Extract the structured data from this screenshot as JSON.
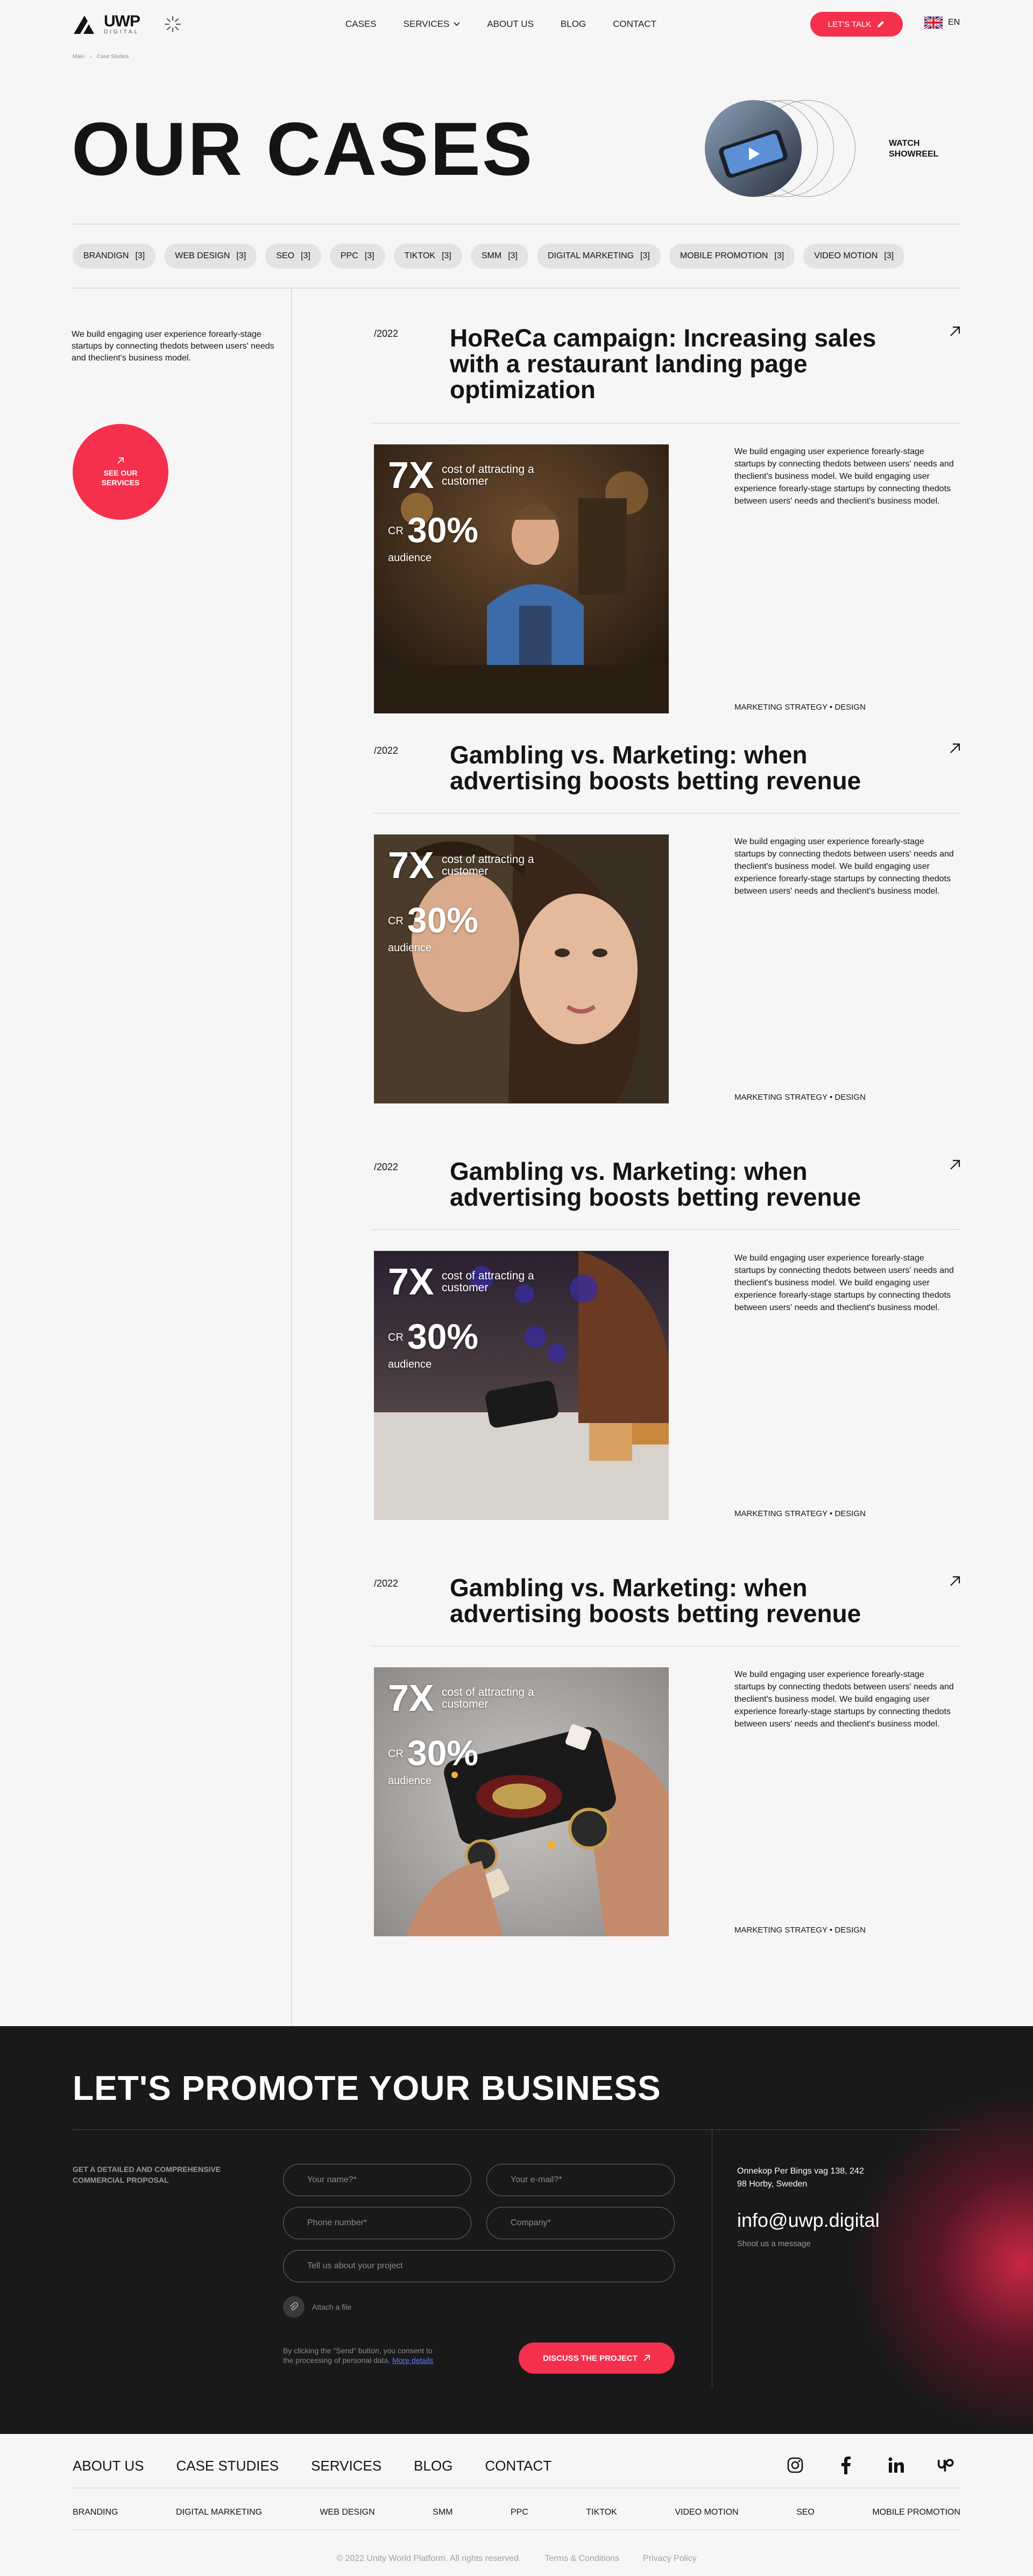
{
  "header": {
    "logo_text": "UWP",
    "logo_sub": "DIGITAL",
    "nav": [
      "CASES",
      "SERVICES",
      "ABOUT US",
      "BLOG",
      "CONTACT"
    ],
    "cta": "LET'S TALK",
    "lang": "EN"
  },
  "breadcrumb": [
    "Main",
    "Case Studies"
  ],
  "hero": {
    "title": "OUR CASES",
    "showreel_label_1": "WATCH",
    "showreel_label_2": "SHOWREEL"
  },
  "filters": [
    {
      "label": "BRANDIGN",
      "count": "[3]"
    },
    {
      "label": "WEB DESIGN",
      "count": "[3]"
    },
    {
      "label": "SEO",
      "count": "[3]"
    },
    {
      "label": "PPC",
      "count": "[3]"
    },
    {
      "label": "TIKTOK",
      "count": "[3]"
    },
    {
      "label": "SMM",
      "count": "[3]"
    },
    {
      "label": "DIGITAL MARKETING",
      "count": "[3]"
    },
    {
      "label": "MOBILE PROMOTION",
      "count": "[3]"
    },
    {
      "label": "VIDEO MOTION",
      "count": "[3]"
    }
  ],
  "sidebar": {
    "intro": "We build engaging user experience forearly-stage startups by connecting thedots between users' needs and theclient's business model.",
    "button_line1": "SEE OUR",
    "button_line2": "SERVICES"
  },
  "cases": [
    {
      "year": "/2022",
      "title": "HoReCa campaign: Increasing sales with a restaurant landing page optimization",
      "stat_big": "7X",
      "stat_big_label": "cost of attracting a customer",
      "stat_cr": "CR",
      "stat_pct": "30%",
      "stat_aud": "audience",
      "desc": "We build engaging user experience forearly-stage startups by connecting thedots between users' needs and theclient's business model. We build engaging user experience forearly-stage startups by connecting thedots between users' needs and theclient's business model.",
      "tags": "MARKETING STRATEGY • DESIGN"
    },
    {
      "year": "/2022",
      "title": "Gambling vs. Marketing: when advertising boosts betting revenue",
      "stat_big": "7X",
      "stat_big_label": "cost of attracting a customer",
      "stat_cr": "CR",
      "stat_pct": "30%",
      "stat_aud": "audience",
      "desc": "We build engaging user experience forearly-stage startups by connecting thedots between users' needs and theclient's business model. We build engaging user experience forearly-stage startups by connecting thedots between users' needs and theclient's business model.",
      "tags": "MARKETING STRATEGY • DESIGN"
    },
    {
      "year": "/2022",
      "title": "Gambling vs. Marketing: when advertising boosts betting revenue",
      "stat_big": "7X",
      "stat_big_label": "cost of attracting a customer",
      "stat_cr": "CR",
      "stat_pct": "30%",
      "stat_aud": "audience",
      "desc": "We build engaging user experience forearly-stage startups by connecting thedots between users' needs and theclient's business model. We build engaging user experience forearly-stage startups by connecting thedots between users' needs and theclient's business model.",
      "tags": "MARKETING STRATEGY • DESIGN"
    },
    {
      "year": "/2022",
      "title": "Gambling vs. Marketing: when advertising boosts betting revenue",
      "stat_big": "7X",
      "stat_big_label": "cost of attracting a customer",
      "stat_cr": "CR",
      "stat_pct": "30%",
      "stat_aud": "audience",
      "desc": "We build engaging user experience forearly-stage startups by connecting thedots between users' needs and theclient's business model. We build engaging user experience forearly-stage startups by connecting thedots between users' needs and theclient's business model.",
      "tags": "MARKETING STRATEGY • DESIGN"
    }
  ],
  "promo": {
    "title": "LET'S PROMOTE YOUR BUSINESS",
    "side": "GET A DETAILED AND COMPREHENSIVE COMMERCIAL PROPOSAL",
    "name_ph": "Your name?*",
    "email_ph": "Your e-mail?*",
    "phone_ph": "Phone number*",
    "company_ph": "Company*",
    "project_ph": "Tell us about your project",
    "attach": "Attach a file",
    "consent": "By clicking the \"Send\" button, you consent to the processing of personal data.",
    "more": "More details",
    "button": "DISCUSS THE PROJECT",
    "address_1": "Onnekop Per Bings vag 138, 242",
    "address_2": "98 Horby, Sweden",
    "email": "info@uwp.digital",
    "shoot": "Shoot us a message"
  },
  "footer": {
    "nav": [
      "ABOUT US",
      "CASE STUDIES",
      "SERVICES",
      "BLOG",
      "CONTACT"
    ],
    "categories": [
      "BRANDING",
      "DIGITAL MARKETING",
      "WEB DESIGN",
      "SMM",
      "PPC",
      "TIKTOK",
      "VIDEO MOTION",
      "SEO",
      "MOBILE PROMOTION"
    ],
    "copyright": "© 2022 Unity World Platform. All rights reserved.",
    "terms": "Terms & Conditions",
    "privacy": "Privacy Policy",
    "socials": [
      "instagram-icon",
      "facebook-icon",
      "linkedin-icon",
      "upwork-icon"
    ]
  },
  "colors": {
    "accent": "#f5304d",
    "dark": "#191919",
    "bg": "#f6f6f6"
  }
}
